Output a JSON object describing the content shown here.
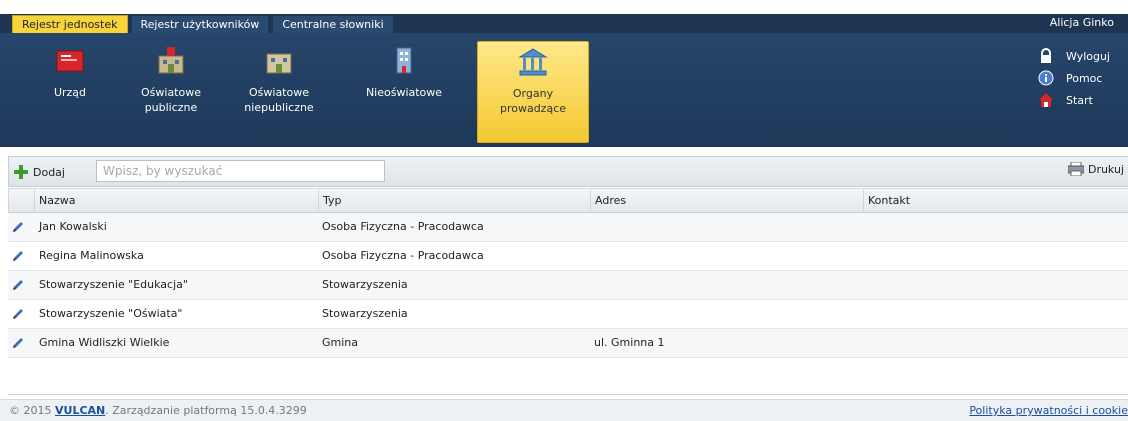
{
  "top_tabs": [
    {
      "label": "Rejestr jednostek",
      "active": true
    },
    {
      "label": "Rejestr użytkowników",
      "active": false
    },
    {
      "label": "Centralne słowniki",
      "active": false
    }
  ],
  "user_name": "Alicja Ginko",
  "ribbon": {
    "buttons": [
      {
        "label_line1": "Urząd",
        "label_line2": "",
        "icon": "office-building-icon"
      },
      {
        "label_line1": "Oświatowe",
        "label_line2": "publiczne",
        "icon": "public-school-icon"
      },
      {
        "label_line1": "Oświatowe",
        "label_line2": "niepubliczne",
        "icon": "private-school-icon"
      },
      {
        "label_line1": "Nieoświatowe",
        "label_line2": "",
        "icon": "non-educational-building-icon"
      },
      {
        "label_line1": "Organy",
        "label_line2": "prowadzące",
        "icon": "governing-body-icon",
        "active": true
      }
    ],
    "right_links": [
      {
        "label": "Wyloguj",
        "icon": "lock-icon"
      },
      {
        "label": "Pomoc",
        "icon": "info-icon"
      },
      {
        "label": "Start",
        "icon": "home-icon"
      }
    ]
  },
  "toolbar": {
    "add_label": "Dodaj",
    "search_placeholder": "Wpisz, by wyszukać",
    "print_label": "Drukuj"
  },
  "table": {
    "columns": [
      "Nazwa",
      "Typ",
      "Adres",
      "Kontakt"
    ],
    "rows": [
      {
        "name": "Jan Kowalski",
        "type": "Osoba Fizyczna - Pracodawca",
        "address": "",
        "contact": ""
      },
      {
        "name": "Regina Malinowska",
        "type": "Osoba Fizyczna - Pracodawca",
        "address": "",
        "contact": ""
      },
      {
        "name": "Stowarzyszenie \"Edukacja\"",
        "type": "Stowarzyszenia",
        "address": "",
        "contact": ""
      },
      {
        "name": "Stowarzyszenie \"Oświata\"",
        "type": "Stowarzyszenia",
        "address": "",
        "contact": ""
      },
      {
        "name": "Gmina Widliszki Wielkie",
        "type": "Gmina",
        "address": "ul. Gminna 1",
        "contact": ""
      }
    ]
  },
  "footer": {
    "copyright_prefix": "© 2015 ",
    "vendor": "VULCAN",
    "copyright_suffix": ". Zarządzanie platformą 15.0.4.3299",
    "privacy_link": "Polityka prywatności i cookie"
  },
  "colors": {
    "ribbon_bg": "#1d3859",
    "active_tab": "#f7d43a",
    "link": "#1b4fa0"
  }
}
